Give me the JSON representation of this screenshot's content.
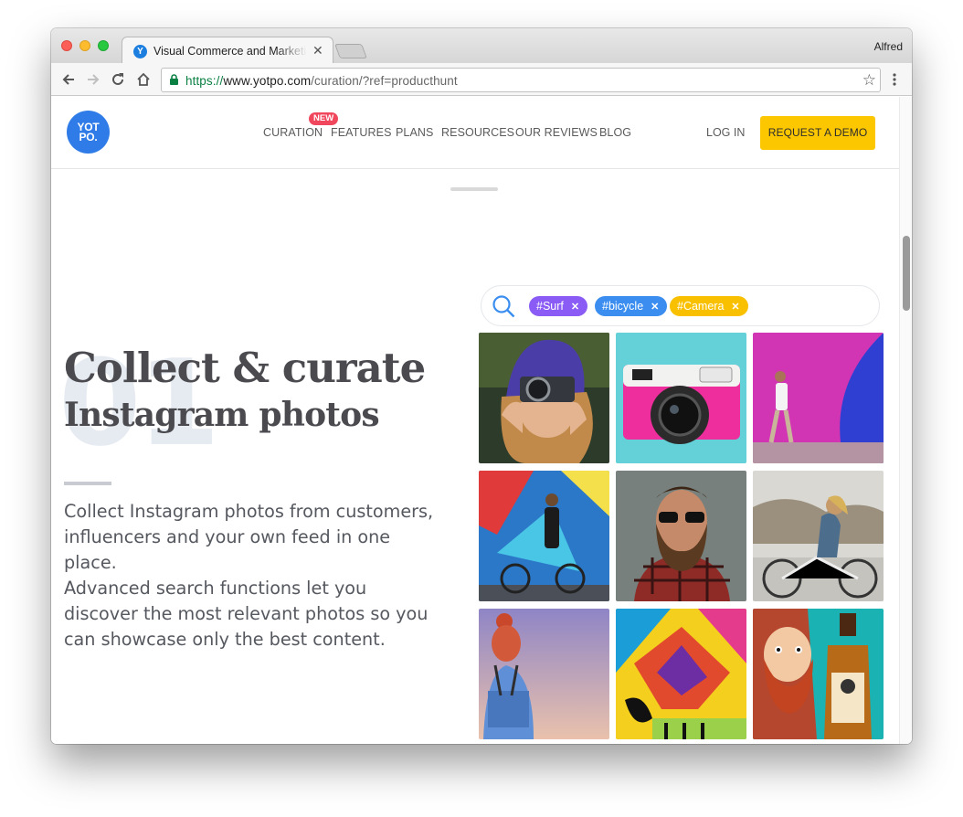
{
  "browser": {
    "tab_title": "Visual Commerce and Marketing",
    "tab_favicon_letter": "Y",
    "profile_name": "Alfred",
    "url": {
      "protocol": "https://",
      "host": "www.yotpo.com",
      "path": "/curation/?ref=producthunt"
    }
  },
  "header": {
    "logo_line1": "YOT",
    "logo_line2": "PO.",
    "nav": [
      {
        "label": "CURATION"
      },
      {
        "label": "FEATURES"
      },
      {
        "label": "PLANS"
      },
      {
        "label": "RESOURCES"
      },
      {
        "label": "OUR REVIEWS"
      },
      {
        "label": "BLOG"
      }
    ],
    "new_badge": "NEW",
    "login": "LOG IN",
    "cta": "REQUEST A DEMO"
  },
  "hero": {
    "number": "01",
    "title_line1": "Collect & curate",
    "title_line2": "Instagram photos",
    "paragraph1": "Collect Instagram photos from customers, influencers and your own feed in one place.",
    "paragraph2": "Advanced search functions let you discover the most relevant photos so you can showcase only the best content."
  },
  "search": {
    "tags": [
      {
        "label": "#Surf",
        "color": "#8a5cf5"
      },
      {
        "label": "#bicycle",
        "color": "#3b8ef0"
      },
      {
        "label": "#Camera",
        "color": "#f9c000"
      }
    ],
    "remove_glyph": "✕"
  },
  "colors": {
    "accent_yellow": "#fdc700",
    "logo_blue": "#2f7ce8",
    "badge_red": "#f0475d"
  }
}
